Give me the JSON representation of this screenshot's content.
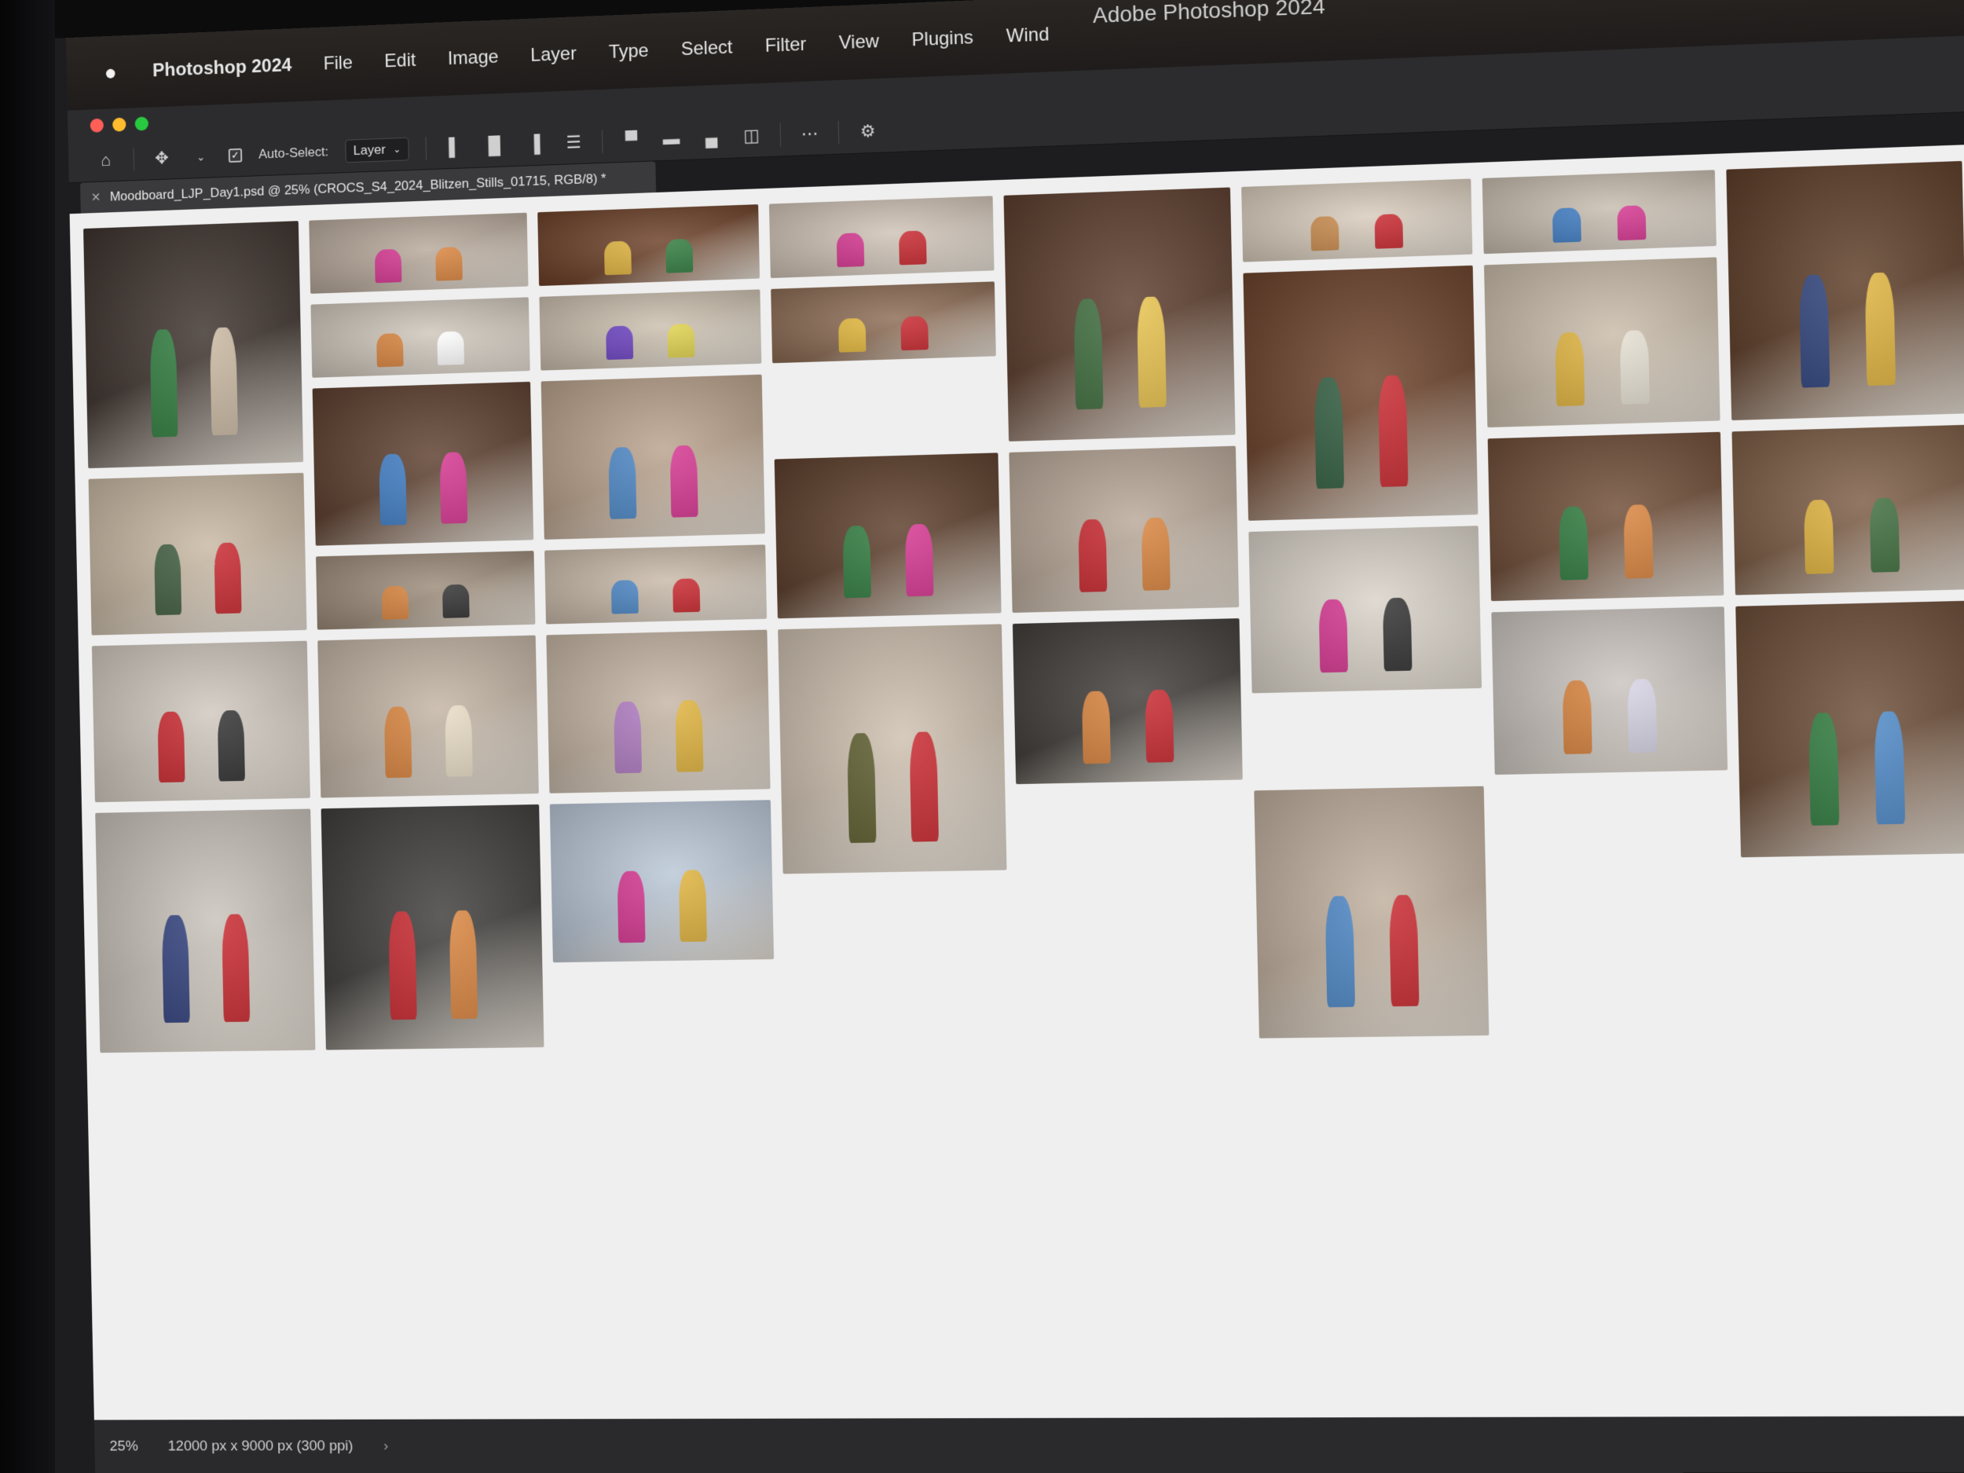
{
  "menubar": {
    "app_name": "Photoshop 2024",
    "items": [
      "File",
      "Edit",
      "Image",
      "Layer",
      "Type",
      "Select",
      "Filter",
      "View",
      "Plugins",
      "Wind"
    ],
    "window_title": "Adobe Photoshop 2024"
  },
  "options": {
    "auto_select_label": "Auto-Select:",
    "auto_select_checked": true,
    "auto_select_target": "Layer"
  },
  "document": {
    "tab_title": "Moodboard_LJP_Day1.psd @ 25% (CROCS_S4_2024_Blitzen_Stills_01715, RGB/8) *"
  },
  "status": {
    "zoom": "25%",
    "doc_size": "12000 px x 9000 px (300 ppi)"
  },
  "colors": {
    "menubar_bg": "#241f1d",
    "panel_bg": "#2c2c2e",
    "canvas_bg": "#efefef",
    "accent_red": "#c8242b",
    "accent_pink": "#d6328f",
    "accent_green": "#2d7a3c",
    "accent_orange": "#d9823a"
  },
  "photos": [
    {
      "cat": "living-room-hearth",
      "bg": "#3a2f2a",
      "c1": "#2b7a3a",
      "c2": "#c9b7a0"
    },
    {
      "cat": "legs-on-stairs",
      "bg": "#b7a89a",
      "c1": "#d6328f",
      "c2": "#d9823a"
    },
    {
      "cat": "stairs-colorful",
      "bg": "#6a3e25",
      "c1": "#e0b23a",
      "c2": "#2d7a3c"
    },
    {
      "cat": "legs-pink-orange",
      "bg": "#cfc2b5",
      "c1": "#d6328f",
      "c2": "#c8242b"
    },
    {
      "cat": "christmas-tree",
      "bg": "#5a3a2a",
      "c1": "#3b6b3a",
      "c2": "#e8c24a"
    },
    {
      "cat": "legs-dancing",
      "bg": "#d8cbbb",
      "c1": "#c98a4a",
      "c2": "#c8242b"
    },
    {
      "cat": "kid-blue-sweater",
      "bg": "#c7bcae",
      "c1": "#3c7bc4",
      "c2": "#d6328f"
    },
    {
      "cat": "legs-on-stairs-2",
      "bg": "#5b3a24",
      "c1": "#2a3f7a",
      "c2": "#e0b23a"
    },
    {
      "cat": "partial-wall",
      "bg": "#cfc6bb",
      "c1": "#d9823a",
      "c2": "#ffffff"
    },
    {
      "cat": "gifts-on-rug",
      "bg": "#cbbfae",
      "c1": "#6a3fc2",
      "c2": "#e0d24a"
    },
    {
      "cat": "kid-yellow-pants",
      "bg": "#8b6a52",
      "c1": "#e6b93a",
      "c2": "#c8242b"
    },
    {
      "cat": "family-on-stairs",
      "bg": "#6a4028",
      "c1": "#2d5a3c",
      "c2": "#c8242b"
    },
    {
      "cat": "yellow-socks",
      "bg": "#c9bba8",
      "c1": "#e0b23a",
      "c2": "#e6e0d2"
    },
    {
      "cat": "three-dancing",
      "bg": "#5a3c2b",
      "c1": "#3c7bc4",
      "c2": "#d6328f"
    },
    {
      "cat": "woman-blue-sweater",
      "bg": "#b9a18b",
      "c1": "#4a86c6",
      "c2": "#d6328f"
    },
    {
      "cat": "father-daughter",
      "bg": "#c7b7a2",
      "c1": "#3d5a3c",
      "c2": "#c8242b"
    },
    {
      "cat": "three-friends-laughing",
      "bg": "#5a3b28",
      "c1": "#2d7a3c",
      "c2": "#d6328f"
    },
    {
      "cat": "red-clogs-closeup",
      "bg": "#b8a797",
      "c1": "#c8242b",
      "c2": "#d9823a"
    },
    {
      "cat": "woman-dancing-green",
      "bg": "#6d4a34",
      "c1": "#2d7a3c",
      "c2": "#d9823a"
    },
    {
      "cat": "girl-christmas-tree",
      "bg": "#7a5a42",
      "c1": "#e0b23a",
      "c2": "#3b6b3a"
    },
    {
      "cat": "legs-near-tree",
      "bg": "#9b8a78",
      "c1": "#d9823a",
      "c2": "#2d2d2d"
    },
    {
      "cat": "gift-exchange",
      "bg": "#c8b9a8",
      "c1": "#4a86c6",
      "c2": "#c8242b"
    },
    {
      "cat": "wall-charms",
      "bg": "#d9d2c8",
      "c1": "#d6328f",
      "c2": "#2d2d2d"
    },
    {
      "cat": "crocs-on-wall",
      "bg": "#cfc7bd",
      "c1": "#c8242b",
      "c2": "#2d2d2d"
    },
    {
      "cat": "dancing-in-living-room",
      "bg": "#c2b3a3",
      "c1": "#d9823a",
      "c2": "#e8dcc4"
    },
    {
      "cat": "girl-with-gift",
      "bg": "#c5b5a4",
      "c1": "#b07ac2",
      "c2": "#e0b23a"
    },
    {
      "cat": "man-olive-shirt",
      "bg": "#cdbfae",
      "c1": "#5a5a2a",
      "c2": "#c8242b"
    },
    {
      "cat": "couch-relaxing",
      "bg": "#3e3a36",
      "c1": "#d9823a",
      "c2": "#c8242b"
    },
    {
      "cat": "woman-crafting",
      "bg": "#c9c3bd",
      "c1": "#d9823a",
      "c2": "#d8d4e6"
    },
    {
      "cat": "group-dancing",
      "bg": "#6a4a34",
      "c1": "#2d7a3c",
      "c2": "#4a86c6"
    },
    {
      "cat": "family-kitchen",
      "bg": "#c7c1b8",
      "c1": "#2d3d7a",
      "c2": "#c8242b"
    },
    {
      "cat": "reading-by-fire",
      "bg": "#3c3a38",
      "c1": "#c8242b",
      "c2": "#d9823a"
    },
    {
      "cat": "table-crafts",
      "bg": "#b9c6d6",
      "c1": "#d6328f",
      "c2": "#e0b23a"
    },
    {
      "cat": "kids-on-floor",
      "bg": "#bfae9c",
      "c1": "#4a86c6",
      "c2": "#c8242b"
    }
  ]
}
